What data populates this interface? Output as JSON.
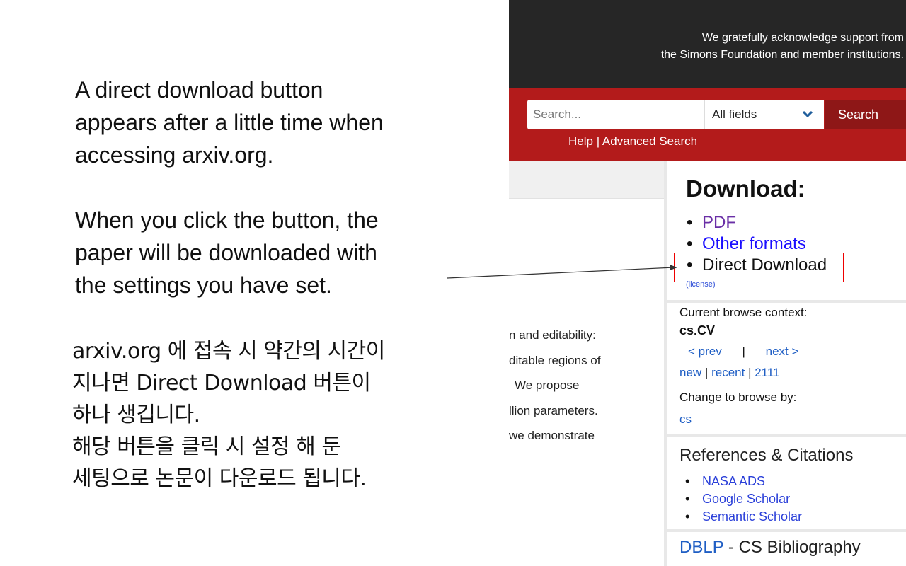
{
  "explanation": {
    "en1": [
      "A direct download button",
      "appears after a little time when",
      "accessing arxiv.org."
    ],
    "en2": [
      "When you click the button, the",
      "paper will be downloaded with",
      "the settings you have set."
    ],
    "ko": [
      "arxiv.org 에 접속 시 약간의 시간이",
      "지나면 Direct Download 버튼이",
      "하나 생깁니다.",
      "해당 버튼을 클릭 시 설정 해 둔",
      "세팅으로 논문이 다운로드 됩니다."
    ]
  },
  "header": {
    "ack_line1": "We gratefully acknowledge support from",
    "ack_line2": "the Simons Foundation and member institutions."
  },
  "search": {
    "placeholder": "Search...",
    "field_value": "All fields",
    "button_label": "Search",
    "help_link": "Help",
    "separator": "|",
    "advanced_link": "Advanced Search"
  },
  "abstract_fragments": [
    "n and editability:",
    "ditable regions of",
    "We propose",
    "llion parameters.",
    "we demonstrate"
  ],
  "download": {
    "title": "Download:",
    "pdf": "PDF",
    "other_formats": "Other formats",
    "direct_download": "Direct Download",
    "license": "(license)"
  },
  "browse": {
    "label": "Current browse context:",
    "context": "cs.CV",
    "prev": "< prev",
    "nav_sep": "|",
    "next": "next >",
    "new": "new",
    "recent": "recent",
    "id": "2111",
    "pipe": "|",
    "change_label": "Change to browse by:",
    "cs": "cs"
  },
  "refs": {
    "title": "References & Citations",
    "items": [
      "NASA ADS",
      "Google Scholar",
      "Semantic Scholar"
    ]
  },
  "dblp": {
    "link": "DBLP",
    "rest": " - CS Bibliography"
  },
  "colors": {
    "header_dark": "#262626",
    "arxiv_red": "#b31b1b",
    "highlight_red": "#e00000",
    "link_blue": "#1a0dff",
    "visited_purple": "#6a2fa6"
  }
}
